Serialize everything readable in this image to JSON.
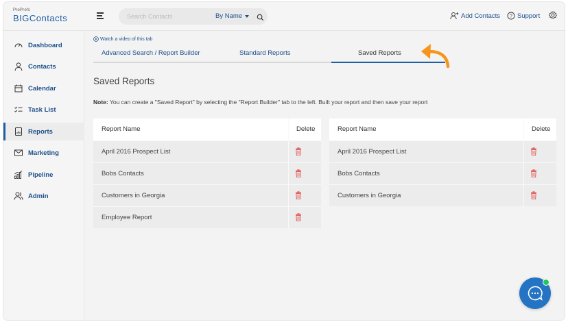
{
  "brand": {
    "small": "ProProfs",
    "name": "BIGContacts"
  },
  "search": {
    "placeholder": "Search Contacts",
    "by_label": "By Name"
  },
  "header_links": {
    "add_contacts": "Add Contacts",
    "support": "Support"
  },
  "sidebar": {
    "items": [
      {
        "label": "Dashboard",
        "icon": "dashboard-icon"
      },
      {
        "label": "Contacts",
        "icon": "person-icon"
      },
      {
        "label": "Calendar",
        "icon": "calendar-icon"
      },
      {
        "label": "Task List",
        "icon": "checklist-icon"
      },
      {
        "label": "Reports",
        "icon": "report-icon",
        "active": true
      },
      {
        "label": "Marketing",
        "icon": "mail-icon"
      },
      {
        "label": "Pipeline",
        "icon": "bar-chart-icon"
      },
      {
        "label": "Admin",
        "icon": "admin-users-icon"
      }
    ]
  },
  "main": {
    "watch_video": "Watch a video of this tab",
    "tabs": [
      {
        "label": "Advanced Search / Report Builder"
      },
      {
        "label": "Standard Reports"
      },
      {
        "label": "Saved Reports",
        "active": true
      }
    ],
    "title": "Saved Reports",
    "note_prefix": "Note:",
    "note_text": "You can create a \"Saved Report\" by selecting the \"Report Builder\" tab to the left. Built your report and then save your report",
    "tables": [
      {
        "columns": [
          "Report Name",
          "Delete"
        ],
        "rows": [
          "April 2016 Prospect List",
          "Bobs Contacts",
          "Customers in Georgia",
          "Employee Report"
        ]
      },
      {
        "columns": [
          "Report Name",
          "Delete"
        ],
        "rows": [
          "April 2016 Prospect List",
          "Bobs Contacts",
          "Customers in Georgia"
        ]
      }
    ]
  },
  "colors": {
    "accent": "#1d5fa5",
    "trash": "#e35b5b",
    "arrow": "#f7941d",
    "chat": "#2474c3",
    "online": "#22c55e"
  }
}
